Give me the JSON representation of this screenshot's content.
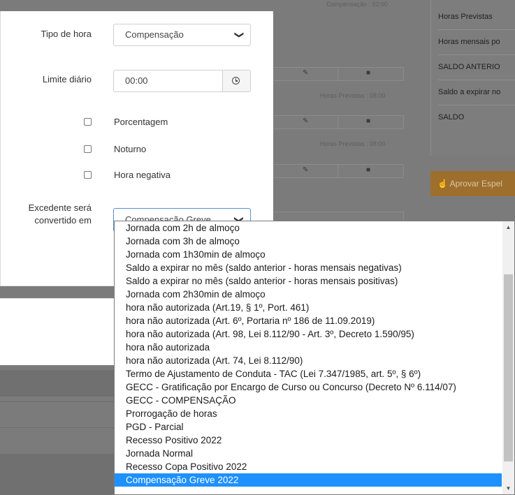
{
  "background": {
    "captions": [
      "Compensação : 02:00",
      "Horas Previstas : 08:00",
      "Horas Previstas : 08:00"
    ],
    "summary_rows": [
      "Horas Previstas",
      "Horas mensais po",
      "SALDO ANTERIO",
      "Saldo a expirar no",
      "SALDO"
    ],
    "approve_label": "Aprovar Espel"
  },
  "form": {
    "tipo_label": "Tipo de hora",
    "tipo_value": "Compensação",
    "limite_label": "Limite diário",
    "limite_value": "00:00",
    "checkboxes": [
      {
        "label": "Porcentagem",
        "checked": false
      },
      {
        "label": "Noturno",
        "checked": false
      },
      {
        "label": "Hora negativa",
        "checked": false
      }
    ],
    "excedente_label": "Excedente será convertido em",
    "excedente_value": "Compensação Greve"
  },
  "dropdown": {
    "options": [
      "Jornada com 2h de almoço",
      "Jornada com 3h de almoço",
      "Jornada com 1h30min de almoço",
      "Saldo a expirar no mês (saldo anterior - horas mensais negativas)",
      "Saldo a expirar no mês (saldo anterior - horas mensais positivas)",
      "Jornada com 2h30min de almoço",
      "hora não autorizada (Art.19, § 1º, Port. 461)",
      "hora não autorizada (Art. 6º, Portaria nº 186 de 11.09.2019)",
      "hora não autorizada (Art. 98, Lei 8.112/90 - Art. 3º, Decreto 1.590/95)",
      "hora não autorizada",
      "hora não autorizada (Art. 74, Lei 8.112/90)",
      "Termo de Ajustamento de Conduta - TAC (Lei 7.347/1985, art. 5º, § 6º)",
      "GECC - Gratificação por Encargo de Curso ou Concurso (Decreto Nº 6.114/07)",
      "GECC - COMPENSAÇÃO",
      "Prorrogação de horas",
      "PGD - Parcial",
      "Recesso Positivo 2022",
      "Jornada Normal",
      "Recesso Copa Positivo 2022",
      "Compensação Greve 2022"
    ],
    "selected": "Compensação Greve 2022"
  },
  "icons": {
    "chevron": "chevron-down-icon",
    "clock": "clock-icon",
    "scroll_up": "triangle-up-icon",
    "scroll_down": "triangle-down-icon"
  }
}
